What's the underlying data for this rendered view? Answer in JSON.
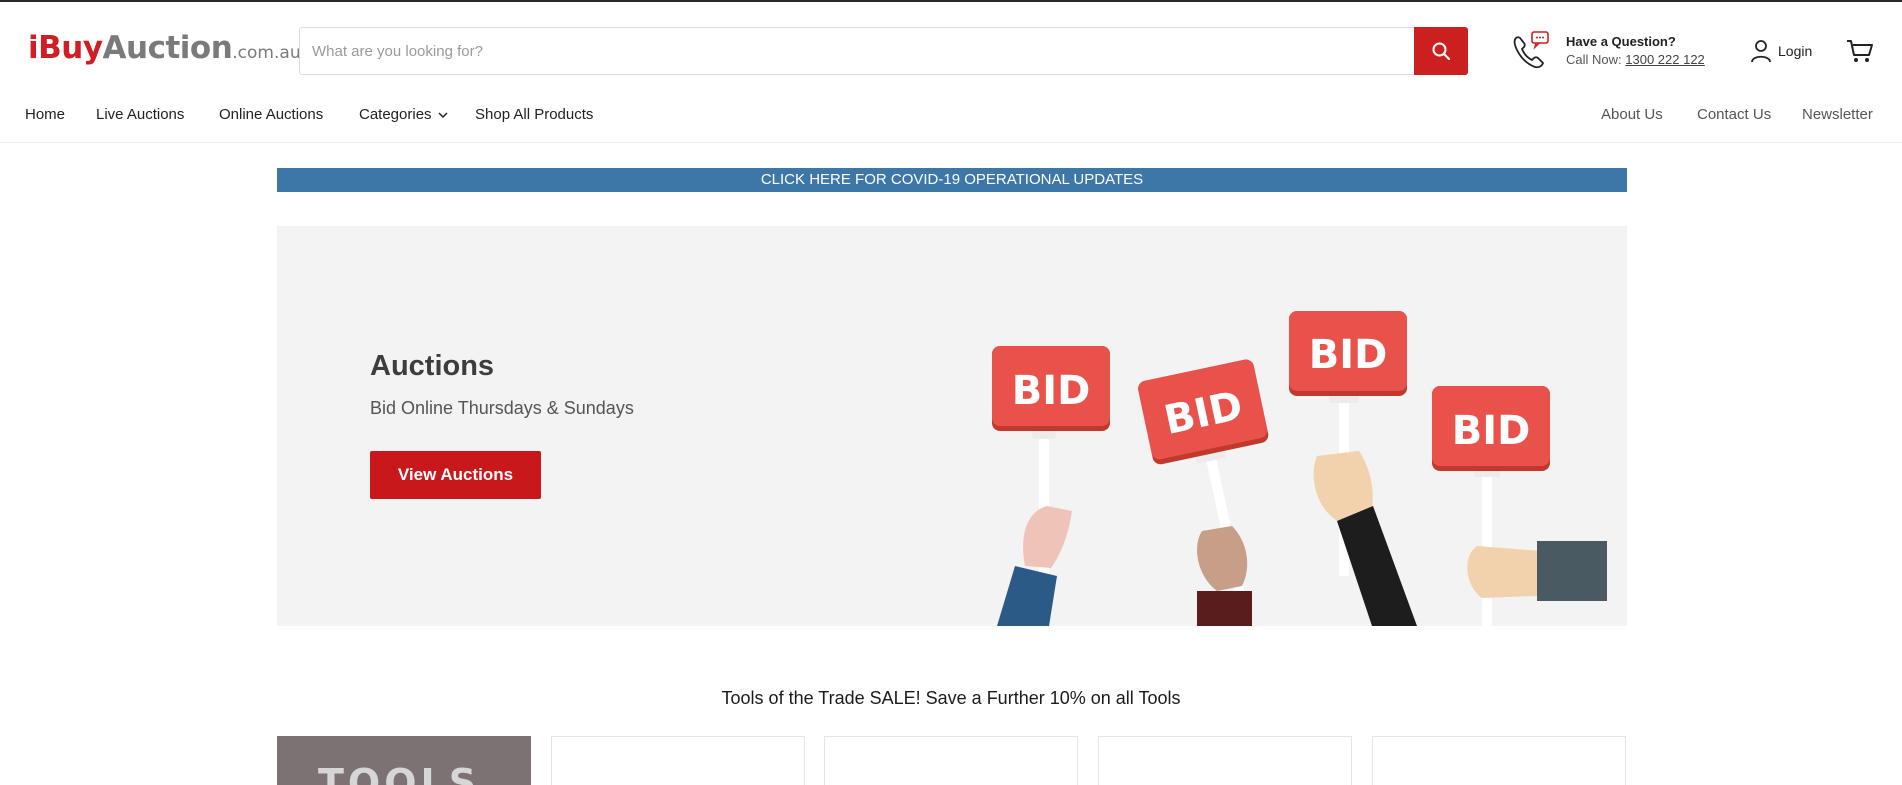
{
  "brand": {
    "logo_part1": "iBuy",
    "logo_part2": "Auction",
    "logo_part3": ".com.au",
    "accent_color": "#cc1f1f"
  },
  "search": {
    "placeholder": "What are you looking for?",
    "button_icon": "search-icon"
  },
  "help": {
    "question": "Have a Question?",
    "call_label": "Call Now:",
    "phone_number": "1300 222 122",
    "icon": "phone-chat-icon"
  },
  "account": {
    "login_label": "Login",
    "login_icon": "user-icon",
    "cart_icon": "cart-icon"
  },
  "nav": {
    "left": [
      {
        "label": "Home"
      },
      {
        "label": "Live Auctions"
      },
      {
        "label": "Online Auctions"
      },
      {
        "label": "Categories"
      },
      {
        "label": "Shop All Products"
      }
    ],
    "right": [
      {
        "label": "About Us"
      },
      {
        "label": "Contact Us"
      },
      {
        "label": "Newsletter"
      }
    ]
  },
  "covid_banner": {
    "text": "CLICK HERE FOR COVID-19 OPERATIONAL UPDATES",
    "color": "#3c77a8"
  },
  "hero": {
    "title": "Auctions",
    "subtitle": "Bid Online Thursdays & Sundays",
    "cta_label": "View Auctions",
    "sign_text": "BID"
  },
  "promo": {
    "title": "Tools of the Trade SALE! Save a Further 10% on all Tools",
    "first_tile_text": "TOOLS"
  }
}
